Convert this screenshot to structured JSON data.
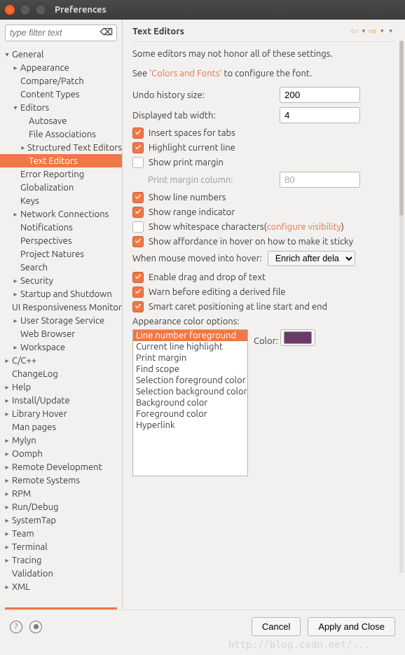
{
  "window": {
    "title": "Preferences"
  },
  "sidebar": {
    "filter_placeholder": "type filter text",
    "items": [
      {
        "d": 1,
        "a": "open",
        "label": "General"
      },
      {
        "d": 2,
        "a": "closed",
        "label": "Appearance"
      },
      {
        "d": 2,
        "a": "none",
        "label": "Compare/Patch"
      },
      {
        "d": 2,
        "a": "none",
        "label": "Content Types"
      },
      {
        "d": 2,
        "a": "open",
        "label": "Editors"
      },
      {
        "d": 3,
        "a": "none",
        "label": "Autosave"
      },
      {
        "d": 3,
        "a": "none",
        "label": "File Associations"
      },
      {
        "d": 3,
        "a": "closed",
        "label": "Structured Text Editors"
      },
      {
        "d": 3,
        "a": "none",
        "label": "Text Editors",
        "selected": true
      },
      {
        "d": 2,
        "a": "none",
        "label": "Error Reporting"
      },
      {
        "d": 2,
        "a": "none",
        "label": "Globalization"
      },
      {
        "d": 2,
        "a": "none",
        "label": "Keys"
      },
      {
        "d": 2,
        "a": "closed",
        "label": "Network Connections"
      },
      {
        "d": 2,
        "a": "none",
        "label": "Notifications"
      },
      {
        "d": 2,
        "a": "none",
        "label": "Perspectives"
      },
      {
        "d": 2,
        "a": "none",
        "label": "Project Natures"
      },
      {
        "d": 2,
        "a": "none",
        "label": "Search"
      },
      {
        "d": 2,
        "a": "closed",
        "label": "Security"
      },
      {
        "d": 2,
        "a": "closed",
        "label": "Startup and Shutdown"
      },
      {
        "d": 2,
        "a": "none",
        "label": "UI Responsiveness Monitoring"
      },
      {
        "d": 2,
        "a": "closed",
        "label": "User Storage Service"
      },
      {
        "d": 2,
        "a": "none",
        "label": "Web Browser"
      },
      {
        "d": 2,
        "a": "closed",
        "label": "Workspace"
      },
      {
        "d": 1,
        "a": "closed",
        "label": "C/C++"
      },
      {
        "d": 1,
        "a": "none",
        "label": "ChangeLog"
      },
      {
        "d": 1,
        "a": "closed",
        "label": "Help"
      },
      {
        "d": 1,
        "a": "closed",
        "label": "Install/Update"
      },
      {
        "d": 1,
        "a": "closed",
        "label": "Library Hover"
      },
      {
        "d": 1,
        "a": "none",
        "label": "Man pages"
      },
      {
        "d": 1,
        "a": "closed",
        "label": "Mylyn"
      },
      {
        "d": 1,
        "a": "closed",
        "label": "Oomph"
      },
      {
        "d": 1,
        "a": "closed",
        "label": "Remote Development"
      },
      {
        "d": 1,
        "a": "closed",
        "label": "Remote Systems"
      },
      {
        "d": 1,
        "a": "closed",
        "label": "RPM"
      },
      {
        "d": 1,
        "a": "closed",
        "label": "Run/Debug"
      },
      {
        "d": 1,
        "a": "closed",
        "label": "SystemTap"
      },
      {
        "d": 1,
        "a": "closed",
        "label": "Team"
      },
      {
        "d": 1,
        "a": "closed",
        "label": "Terminal"
      },
      {
        "d": 1,
        "a": "closed",
        "label": "Tracing"
      },
      {
        "d": 1,
        "a": "none",
        "label": "Validation"
      },
      {
        "d": 1,
        "a": "closed",
        "label": "XML"
      }
    ]
  },
  "page": {
    "title": "Text Editors",
    "note": "Some editors may not honor all of these settings.",
    "see_pre": "See ",
    "see_link": "'Colors and Fonts'",
    "see_post": " to configure the font.",
    "undo_label": "Undo history size:",
    "undo_value": "200",
    "tab_label": "Displayed tab width:",
    "tab_value": "4",
    "cb_insert_spaces": "Insert spaces for tabs",
    "cb_highlight_line": "Highlight current line",
    "cb_print_margin": "Show print margin",
    "print_col_label": "Print margin column:",
    "print_col_value": "80",
    "cb_line_numbers": "Show line numbers",
    "cb_range_indicator": "Show range indicator",
    "cb_whitespace_pre": "Show whitespace characters(",
    "cb_whitespace_link": "configure visibility",
    "cb_whitespace_post": ")",
    "cb_affordance": "Show affordance in hover on how to make it sticky",
    "hover_label": "When mouse moved into hover:",
    "hover_value": "Enrich after delay",
    "cb_dnd": "Enable drag and drop of text",
    "cb_derived": "Warn before editing a derived file",
    "cb_smart_caret": "Smart caret positioning at line start and end",
    "color_options_label": "Appearance color options:",
    "color_label": "Color:",
    "color_items": [
      "Line number foreground",
      "Current line highlight",
      "Print margin",
      "Find scope",
      "Selection foreground color",
      "Selection background color",
      "Background color",
      "Foreground color",
      "Hyperlink"
    ],
    "color_swatch": "#6b3a6b"
  },
  "footer": {
    "cancel": "Cancel",
    "apply_close": "Apply and Close"
  }
}
